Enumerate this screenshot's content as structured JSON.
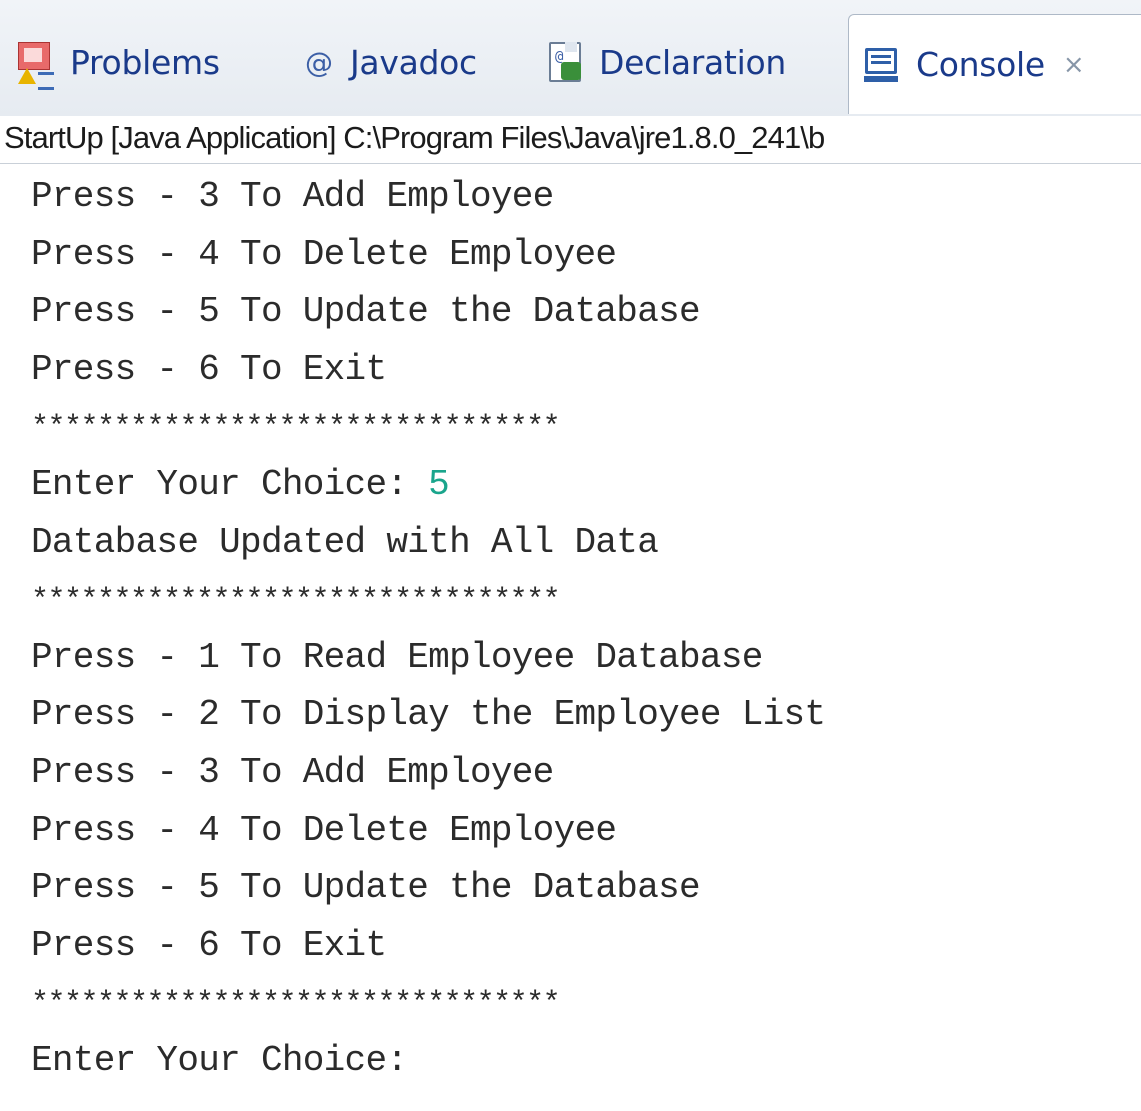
{
  "tabs": [
    {
      "label": "Problems",
      "icon": "problems-icon"
    },
    {
      "label": "Javadoc",
      "icon": "at-sign-icon",
      "icon_glyph": "@"
    },
    {
      "label": "Declaration",
      "icon": "declaration-icon"
    },
    {
      "label": "Console",
      "icon": "console-icon",
      "active": true,
      "close_glyph": "⨯"
    }
  ],
  "launch_info": "StartUp [Java Application] C:\\Program Files\\Java\\jre1.8.0_241\\b",
  "console": {
    "lines": [
      {
        "text": "Press - 3 To Add Employee"
      },
      {
        "text": "Press - 4 To Delete Employee"
      },
      {
        "text": "Press - 5 To Update the Database"
      },
      {
        "text": "Press - 6 To Exit"
      },
      {
        "text": "********************************",
        "kind": "stars"
      },
      {
        "text": "Enter Your Choice: ",
        "input": "5"
      },
      {
        "text": "Database Updated with All Data"
      },
      {
        "text": "********************************",
        "kind": "stars"
      },
      {
        "text": "Press - 1 To Read Employee Database"
      },
      {
        "text": "Press - 2 To Display the Employee List"
      },
      {
        "text": "Press - 3 To Add Employee"
      },
      {
        "text": "Press - 4 To Delete Employee"
      },
      {
        "text": "Press - 5 To Update the Database"
      },
      {
        "text": "Press - 6 To Exit"
      },
      {
        "text": "********************************",
        "kind": "stars"
      },
      {
        "text": "Enter Your Choice:"
      }
    ]
  },
  "colors": {
    "tab_text": "#1a3a8a",
    "output_text": "#2b2b2b",
    "user_input": "#1aa58c"
  }
}
